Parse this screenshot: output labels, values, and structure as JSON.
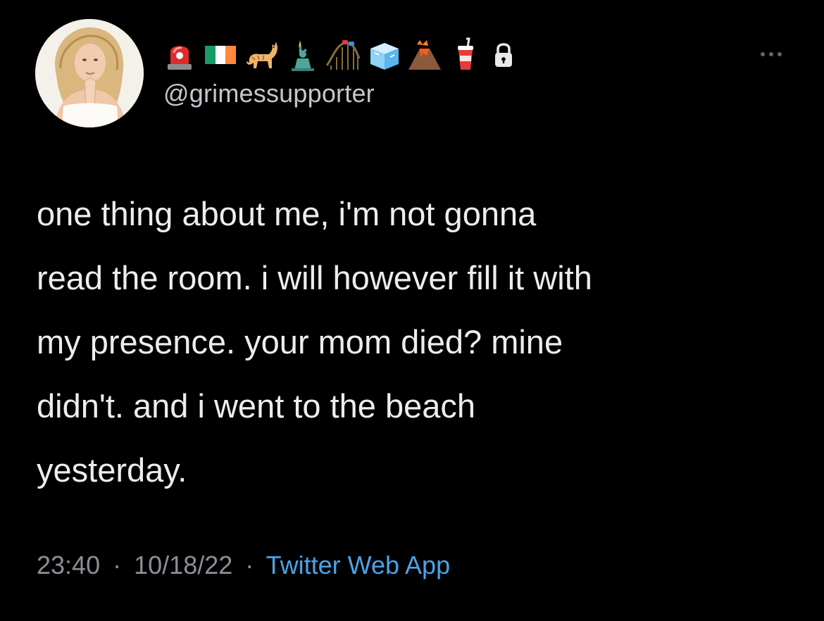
{
  "profile": {
    "handle": "@grimessupporter",
    "display_name_emojis": [
      "police-light-icon",
      "ireland-flag-icon",
      "cat-icon",
      "statue-of-liberty-icon",
      "roller-coaster-icon",
      "ice-cube-icon",
      "volcano-icon",
      "cup-with-straw-icon"
    ],
    "protected_icon": "lock-icon",
    "avatar_icon": "avatar"
  },
  "tweet": {
    "lines": [
      "one thing about me, i'm not gonna",
      "read the room. i will however fill it with",
      "my presence. your mom died? mine",
      "didn't. and i went to the beach",
      "yesterday."
    ]
  },
  "meta": {
    "time": "23:40",
    "separator": "·",
    "date": "10/18/22",
    "source": "Twitter Web App"
  },
  "colors": {
    "background": "#000000",
    "text": "#ebedee",
    "secondary_text": "#8b9096",
    "link": "#4aa3e8"
  },
  "menu": {
    "more_icon": "more-horizontal-icon"
  }
}
